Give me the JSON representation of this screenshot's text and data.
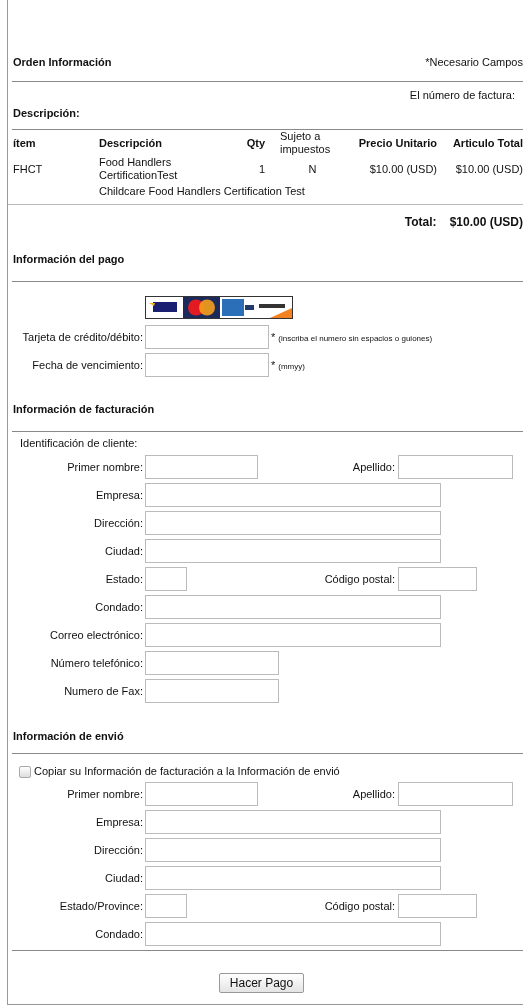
{
  "order": {
    "title": "Orden Información",
    "required_note": "*Necesario Campos",
    "invoice_label": "El número de factura:",
    "description_label": "Descripción:"
  },
  "items_table": {
    "columns": [
      "ítem",
      "Descripción",
      "Qty",
      "Sujeto a impuestos",
      "Precio Unitario",
      "Articulo Total"
    ],
    "rows": [
      {
        "cells": [
          "FHCT",
          "Food Handlers CertificationTest",
          "1",
          "N",
          "$10.00 (USD)",
          "$10.00 (USD)"
        ],
        "note": "Childcare Food Handlers Certification Test"
      }
    ]
  },
  "total": {
    "label": "Total:",
    "value": "$10.00 (USD)"
  },
  "payment": {
    "title": "Información del pago",
    "fields": [
      {
        "label": "Tarjeta de crédito/débito:",
        "kind": "card",
        "mark": "*",
        "hint": "(inscriba el numero sin espacios o guiones)"
      },
      {
        "label": "Fecha de vencimiento:",
        "kind": "card",
        "mark": "*",
        "hint": "(mmyy)"
      }
    ]
  },
  "billing": {
    "title": "Información de facturación",
    "customer_id_label": "Identificación de cliente:",
    "rows": [
      {
        "fields": [
          {
            "label": "Primer nombre:",
            "kind": "short"
          },
          {
            "label": "Apellido:",
            "kind": "last"
          }
        ]
      },
      {
        "fields": [
          {
            "label": "Empresa:",
            "kind": "long"
          }
        ]
      },
      {
        "fields": [
          {
            "label": "Dirección:",
            "kind": "long"
          }
        ]
      },
      {
        "fields": [
          {
            "label": "Ciudad:",
            "kind": "long"
          }
        ]
      },
      {
        "fields": [
          {
            "label": "Estado:",
            "kind": "tiny"
          },
          {
            "label": "Código postal:",
            "kind": "zip"
          }
        ]
      },
      {
        "fields": [
          {
            "label": "Condado:",
            "kind": "long"
          }
        ]
      },
      {
        "fields": [
          {
            "label": "Correo electrónico:",
            "kind": "long"
          }
        ]
      },
      {
        "fields": [
          {
            "label": "Número telefónico:",
            "kind": "phone"
          }
        ]
      },
      {
        "fields": [
          {
            "label": "Numero de Fax:",
            "kind": "phone"
          }
        ]
      }
    ]
  },
  "shipping": {
    "title": "Información de envió",
    "copy_checkbox": {
      "label": "Copiar su Información de facturación a la Información de envió",
      "checked": false
    },
    "rows": [
      {
        "fields": [
          {
            "label": "Primer nombre:",
            "kind": "short"
          },
          {
            "label": "Apellido:",
            "kind": "last"
          }
        ]
      },
      {
        "fields": [
          {
            "label": "Empresa:",
            "kind": "long"
          }
        ]
      },
      {
        "fields": [
          {
            "label": "Dirección:",
            "kind": "long"
          }
        ]
      },
      {
        "fields": [
          {
            "label": "Ciudad:",
            "kind": "long"
          }
        ]
      },
      {
        "fields": [
          {
            "label": "Estado/Province:",
            "kind": "tiny"
          },
          {
            "label": "Código postal:",
            "kind": "zip"
          }
        ]
      },
      {
        "fields": [
          {
            "label": "Condado:",
            "kind": "long"
          }
        ]
      }
    ]
  },
  "submit_button": "Hacer Pago"
}
